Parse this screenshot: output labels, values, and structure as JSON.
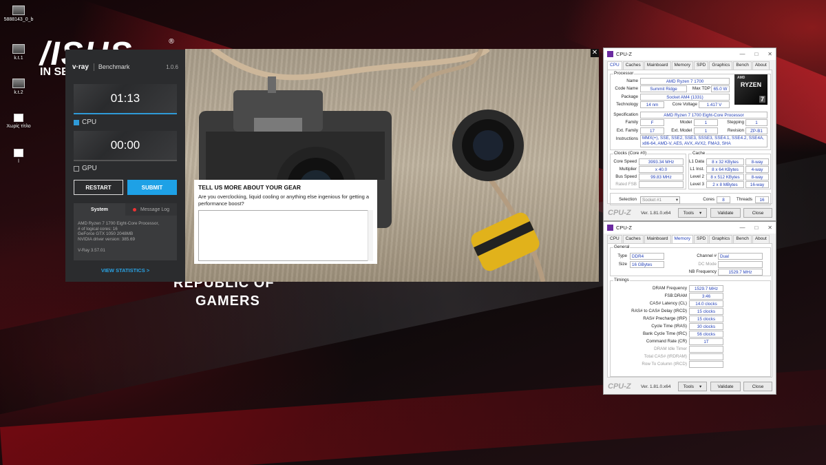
{
  "desktop": {
    "icons": [
      {
        "label": "5888143_0_b"
      },
      {
        "label": "k.t.1"
      },
      {
        "label": "k.t.2"
      },
      {
        "label": "Χωρίς τίτλο"
      },
      {
        "label": "l"
      }
    ],
    "asus_logo": "/ISUS",
    "asus_reg": "®",
    "asus_subtitle": "IN SE",
    "rog_line1": "REPUBLIC OF",
    "rog_line2": "GAMERS"
  },
  "vray": {
    "logo": "v·ray",
    "title": "Benchmark",
    "version": "1.0.6",
    "cpu_timer": "01:13",
    "cpu_label": "CPU",
    "cpu_checked": true,
    "gpu_timer": "00:00",
    "gpu_label": "GPU",
    "gpu_checked": false,
    "restart_label": "RESTART",
    "submit_label": "SUBMIT",
    "tab_system": "System",
    "tab_message_log": "Message Log",
    "system_lines": [
      "AMD Ryzen 7 1700 Eight-Core Processor,",
      "# of logical cores: 16",
      "GeForce GTX 1050 2048MB",
      "NVIDIA driver version: 385.69",
      "",
      "V-Ray 3.57.01"
    ],
    "view_statistics": "VIEW STATISTICS >"
  },
  "feedback": {
    "title": "TELL US MORE ABOUT YOUR GEAR",
    "question": "Are you overclocking, liquid cooling or anything else ingenious for getting a performance boost?",
    "text_value": ""
  },
  "photo": {
    "close": "✕"
  },
  "cpuz": {
    "title": "CPU-Z",
    "tabs": [
      "CPU",
      "Caches",
      "Mainboard",
      "Memory",
      "SPD",
      "Graphics",
      "Bench",
      "About"
    ],
    "brand": "CPU-Z",
    "version": "Ver. 1.81.0.x64",
    "tools": "Tools",
    "validate": "Validate",
    "close": "Close",
    "cpu": {
      "processor_group": "Processor",
      "name_lbl": "Name",
      "name": "AMD Ryzen 7 1700",
      "codename_lbl": "Code Name",
      "codename": "Summit Ridge",
      "maxtdp_lbl": "Max TDP",
      "maxtdp": "65.0 W",
      "package_lbl": "Package",
      "package": "Socket AM4 (1331)",
      "technology_lbl": "Technology",
      "technology": "14 nm",
      "corevoltage_lbl": "Core Voltage",
      "corevoltage": "1.417 V",
      "spec_lbl": "Specification",
      "spec": "AMD Ryzen 7 1700 Eight-Core Processor",
      "family_lbl": "Family",
      "family": "F",
      "model_lbl": "Model",
      "model": "1",
      "stepping_lbl": "Stepping",
      "stepping": "1",
      "extfamily_lbl": "Ext. Family",
      "extfamily": "17",
      "extmodel_lbl": "Ext. Model",
      "extmodel": "1",
      "revision_lbl": "Revision",
      "revision": "ZP-B1",
      "instructions_lbl": "Instructions",
      "instructions": "MMX(+), SSE, SSE2, SSE3, SSSE3, SSE4.1, SSE4.2, SSE4A, x86-64, AMD-V, AES, AVX, AVX2, FMA3, SHA",
      "clocks_group": "Clocks (Core #0)",
      "corespeed_lbl": "Core Speed",
      "corespeed": "3993.34 MHz",
      "multiplier_lbl": "Multiplier",
      "multiplier": "x 40.0",
      "busspeed_lbl": "Bus Speed",
      "busspeed": "99.83 MHz",
      "ratedfsb_lbl": "Rated FSB",
      "ratedfsb": "",
      "cache_group": "Cache",
      "l1data_lbl": "L1 Data",
      "l1data": "8 x 32 KBytes",
      "l1data_way": "8-way",
      "l1inst_lbl": "L1 Inst.",
      "l1inst": "8 x 64 KBytes",
      "l1inst_way": "4-way",
      "level2_lbl": "Level 2",
      "level2": "8 x 512 KBytes",
      "level2_way": "8-way",
      "level3_lbl": "Level 3",
      "level3": "2 x 8 MBytes",
      "level3_way": "16-way",
      "selection_lbl": "Selection",
      "selection": "Socket #1",
      "cores_lbl": "Cores",
      "cores": "8",
      "threads_lbl": "Threads",
      "threads": "16",
      "logo_amd": "AMD",
      "logo_ryzen": "RYZEN",
      "logo_tier": "7"
    },
    "memory": {
      "general_group": "General",
      "type_lbl": "Type",
      "type": "DDR4",
      "channel_lbl": "Channel #",
      "channel": "Dual",
      "size_lbl": "Size",
      "size": "16 GBytes",
      "dcmode_lbl": "DC Mode",
      "dcmode": "",
      "nbfreq_lbl": "NB Frequency",
      "nbfreq": "1529.7 MHz",
      "timings_group": "Timings",
      "dramfreq_lbl": "DRAM Frequency",
      "dramfreq": "1529.7 MHz",
      "fsbdram_lbl": "FSB:DRAM",
      "fsbdram": "3:46",
      "cas_lbl": "CAS# Latency (CL)",
      "cas": "14.0 clocks",
      "trcd_lbl": "RAS# to CAS# Delay (tRCD)",
      "trcd": "15 clocks",
      "trp_lbl": "RAS# Precharge (tRP)",
      "trp": "15 clocks",
      "tras_lbl": "Cycle Time (tRAS)",
      "tras": "30 clocks",
      "trc_lbl": "Bank Cycle Time (tRC)",
      "trc": "56 clocks",
      "cr_lbl": "Command Rate (CR)",
      "cr": "1T",
      "idle_lbl": "DRAM Idle Timer",
      "idle": "",
      "rdram_lbl": "Total CAS# (tRDRAM)",
      "rdram": "",
      "rtc_lbl": "Row To Column (tRCD)",
      "rtc": ""
    }
  },
  "colors": {
    "accent": "#1ea1e6",
    "cpuz_value": "#1f3db7"
  }
}
